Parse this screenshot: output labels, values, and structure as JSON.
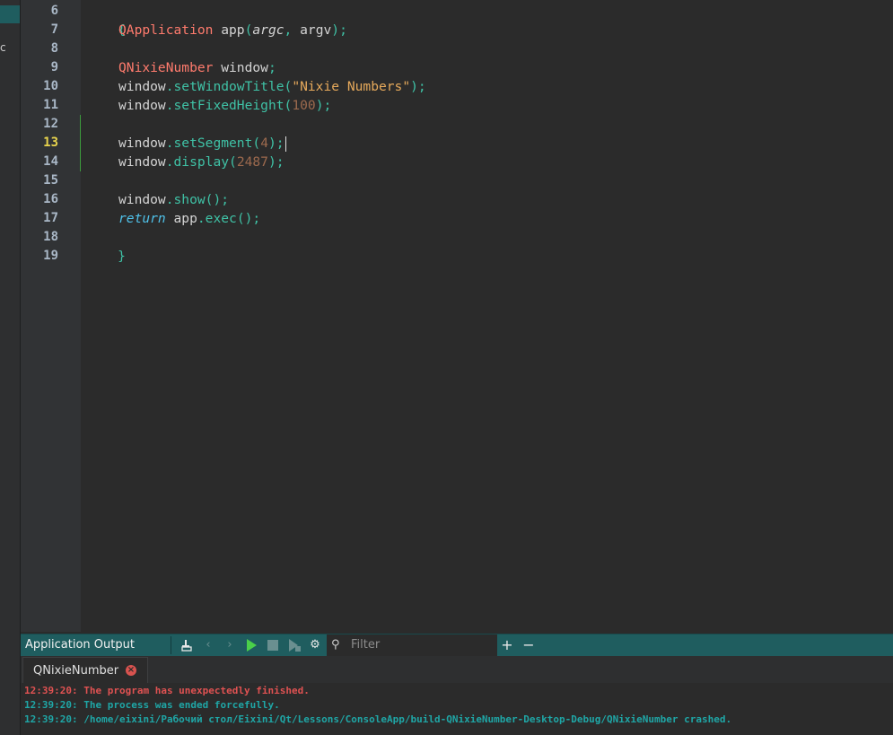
{
  "sidebar": {
    "char": "c"
  },
  "editor": {
    "lines": [
      {
        "num": "6"
      },
      {
        "num": "7"
      },
      {
        "num": "8"
      },
      {
        "num": "9"
      },
      {
        "num": "10"
      },
      {
        "num": "11"
      },
      {
        "num": "12"
      },
      {
        "num": "13"
      },
      {
        "num": "14"
      },
      {
        "num": "15"
      },
      {
        "num": "16"
      },
      {
        "num": "17"
      },
      {
        "num": "18"
      },
      {
        "num": "19"
      }
    ],
    "code": {
      "l6": {
        "brace": "{"
      },
      "l7": {
        "type": "QApplication",
        "var": " app",
        "p1": "(",
        "arg1": "argc",
        "comma": ", ",
        "arg2": "argv",
        "p2": ");"
      },
      "l9": {
        "type": "QNixieNumber",
        "var": " window",
        "semi": ";"
      },
      "l10": {
        "obj": "window",
        "dot": ".",
        "meth": "setWindowTitle",
        "p1": "(",
        "str": "\"Nixie Numbers\"",
        "p2": ");"
      },
      "l11": {
        "obj": "window",
        "dot": ".",
        "meth": "setFixedHeight",
        "p1": "(",
        "num": "100",
        "p2": ");"
      },
      "l13": {
        "obj": "window",
        "dot": ".",
        "meth": "setSegment",
        "p1": "(",
        "num": "4",
        "p2": ");"
      },
      "l14": {
        "obj": "window",
        "dot": ".",
        "meth": "display",
        "p1": "(",
        "num": "2487",
        "p2": ");"
      },
      "l16": {
        "obj": "window",
        "dot": ".",
        "meth": "show",
        "p": "();"
      },
      "l17": {
        "kw": "return",
        "obj": " app",
        "dot": ".",
        "meth": "exec",
        "p": "();"
      },
      "l18": {
        "brace": "}"
      }
    }
  },
  "output": {
    "title": "Application Output",
    "filter_placeholder": "Filter",
    "tab_label": "QNixieNumber",
    "lines": [
      "12:39:20: The program has unexpectedly finished.",
      "12:39:20: The process was ended forcefully.",
      "12:39:20: /home/eixini/Рабочий стол/Eixini/Qt/Lessons/ConsoleApp/build-QNixieNumber-Desktop-Debug/QNixieNumber crashed."
    ],
    "icons": {
      "clear": "clear-icon",
      "prev": "chevron-left-icon",
      "next": "chevron-right-icon",
      "run": "play-icon",
      "stop": "stop-icon",
      "attach": "attach-debugger-icon",
      "settings": "gear-icon",
      "filter": "search-icon",
      "add": "plus-icon",
      "remove": "minus-icon"
    }
  },
  "colors": {
    "accent": "#1f5d5f",
    "error": "#e05252",
    "info": "#1fa6a6",
    "current_line_number": "#e8d44d"
  }
}
